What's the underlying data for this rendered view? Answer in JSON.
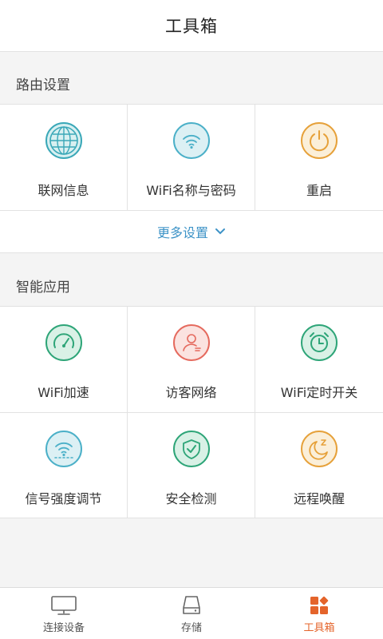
{
  "header": {
    "title": "工具箱"
  },
  "router_section": {
    "title": "路由设置",
    "items": [
      {
        "label": "联网信息",
        "icon": "globe-icon",
        "color": "#3aa8b8"
      },
      {
        "label": "WiFi名称与密码",
        "icon": "wifi-icon",
        "color": "#4bb0c8"
      },
      {
        "label": "重启",
        "icon": "power-icon",
        "color": "#e6a13a"
      }
    ],
    "more_label": "更多设置"
  },
  "smart_section": {
    "title": "智能应用",
    "items": [
      {
        "label": "WiFi加速",
        "icon": "speedometer-icon",
        "color": "#2ea578"
      },
      {
        "label": "访客网络",
        "icon": "guest-user-icon",
        "color": "#e56a5e"
      },
      {
        "label": "WiFi定时开关",
        "icon": "alarm-clock-icon",
        "color": "#2ea578"
      },
      {
        "label": "信号强度调节",
        "icon": "signal-strength-icon",
        "color": "#4bb0c8"
      },
      {
        "label": "安全检测",
        "icon": "shield-check-icon",
        "color": "#2ea578"
      },
      {
        "label": "远程唤醒",
        "icon": "moon-sleep-icon",
        "color": "#e6a13a"
      }
    ]
  },
  "tabbar": {
    "tabs": [
      {
        "label": "连接设备",
        "icon": "monitor-icon",
        "active": false
      },
      {
        "label": "存储",
        "icon": "storage-drive-icon",
        "active": false
      },
      {
        "label": "工具箱",
        "icon": "toolbox-icon",
        "active": true
      }
    ],
    "active_color": "#e4642b"
  }
}
